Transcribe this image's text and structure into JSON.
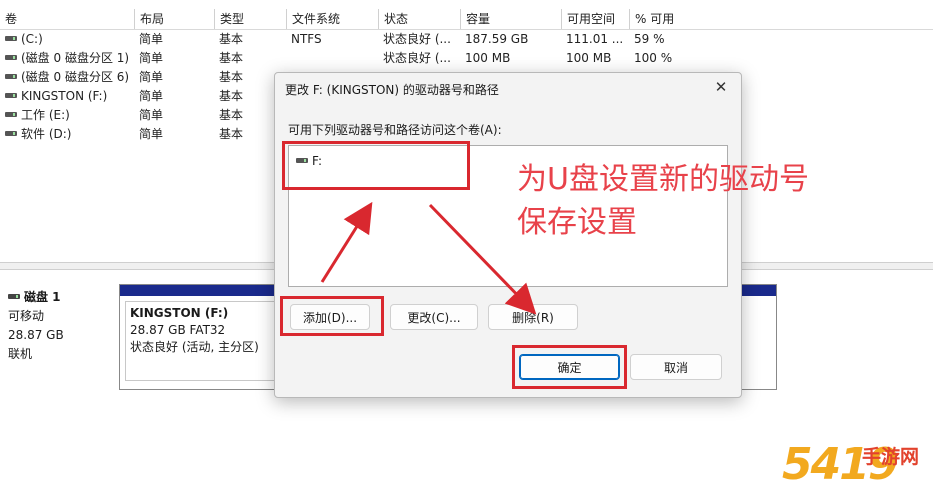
{
  "volume_list": {
    "columns": [
      "卷",
      "布局",
      "类型",
      "文件系统",
      "状态",
      "容量",
      "可用空间",
      "% 可用"
    ],
    "rows": [
      [
        "(C:)",
        "简单",
        "基本",
        "NTFS",
        "状态良好 (...",
        "187.59 GB",
        "111.01 ...",
        "59 %"
      ],
      [
        "(磁盘 0 磁盘分区 1)",
        "简单",
        "基本",
        "",
        "状态良好 (...",
        "100 MB",
        "100 MB",
        "100 %"
      ],
      [
        "(磁盘 0 磁盘分区 6)",
        "简单",
        "基本",
        "",
        "",
        "",
        "",
        "100 %"
      ],
      [
        "KINGSTON (F:)",
        "简单",
        "基本",
        "",
        "",
        "",
        "",
        ""
      ],
      [
        "工作 (E:)",
        "简单",
        "基本",
        "",
        "",
        "",
        "",
        ""
      ],
      [
        "软件 (D:)",
        "简单",
        "基本",
        "",
        "",
        "",
        "",
        ""
      ]
    ]
  },
  "disk_map": {
    "disk_title": "磁盘 1",
    "disk_type": "可移动",
    "disk_size": "28.87 GB",
    "disk_status": "联机",
    "partition_name": "KINGSTON  (F:)",
    "partition_size_fs": "28.87 GB FAT32",
    "partition_status": "状态良好 (活动, 主分区)"
  },
  "dialog": {
    "title": "更改 F: (KINGSTON) 的驱动器号和路径",
    "close_glyph": "✕",
    "prompt": "可用下列驱动器号和路径访问这个卷(A):",
    "list_items": [
      "F:"
    ],
    "add_label": "添加(D)...",
    "change_label": "更改(C)...",
    "remove_label": "删除(R)",
    "ok_label": "确定",
    "cancel_label": "取消"
  },
  "annotation": {
    "line1": "为U盘设置新的驱动号",
    "line2": "保存设置",
    "color": "#e8424a"
  },
  "watermark": {
    "number": "5419",
    "text": "手游网"
  }
}
